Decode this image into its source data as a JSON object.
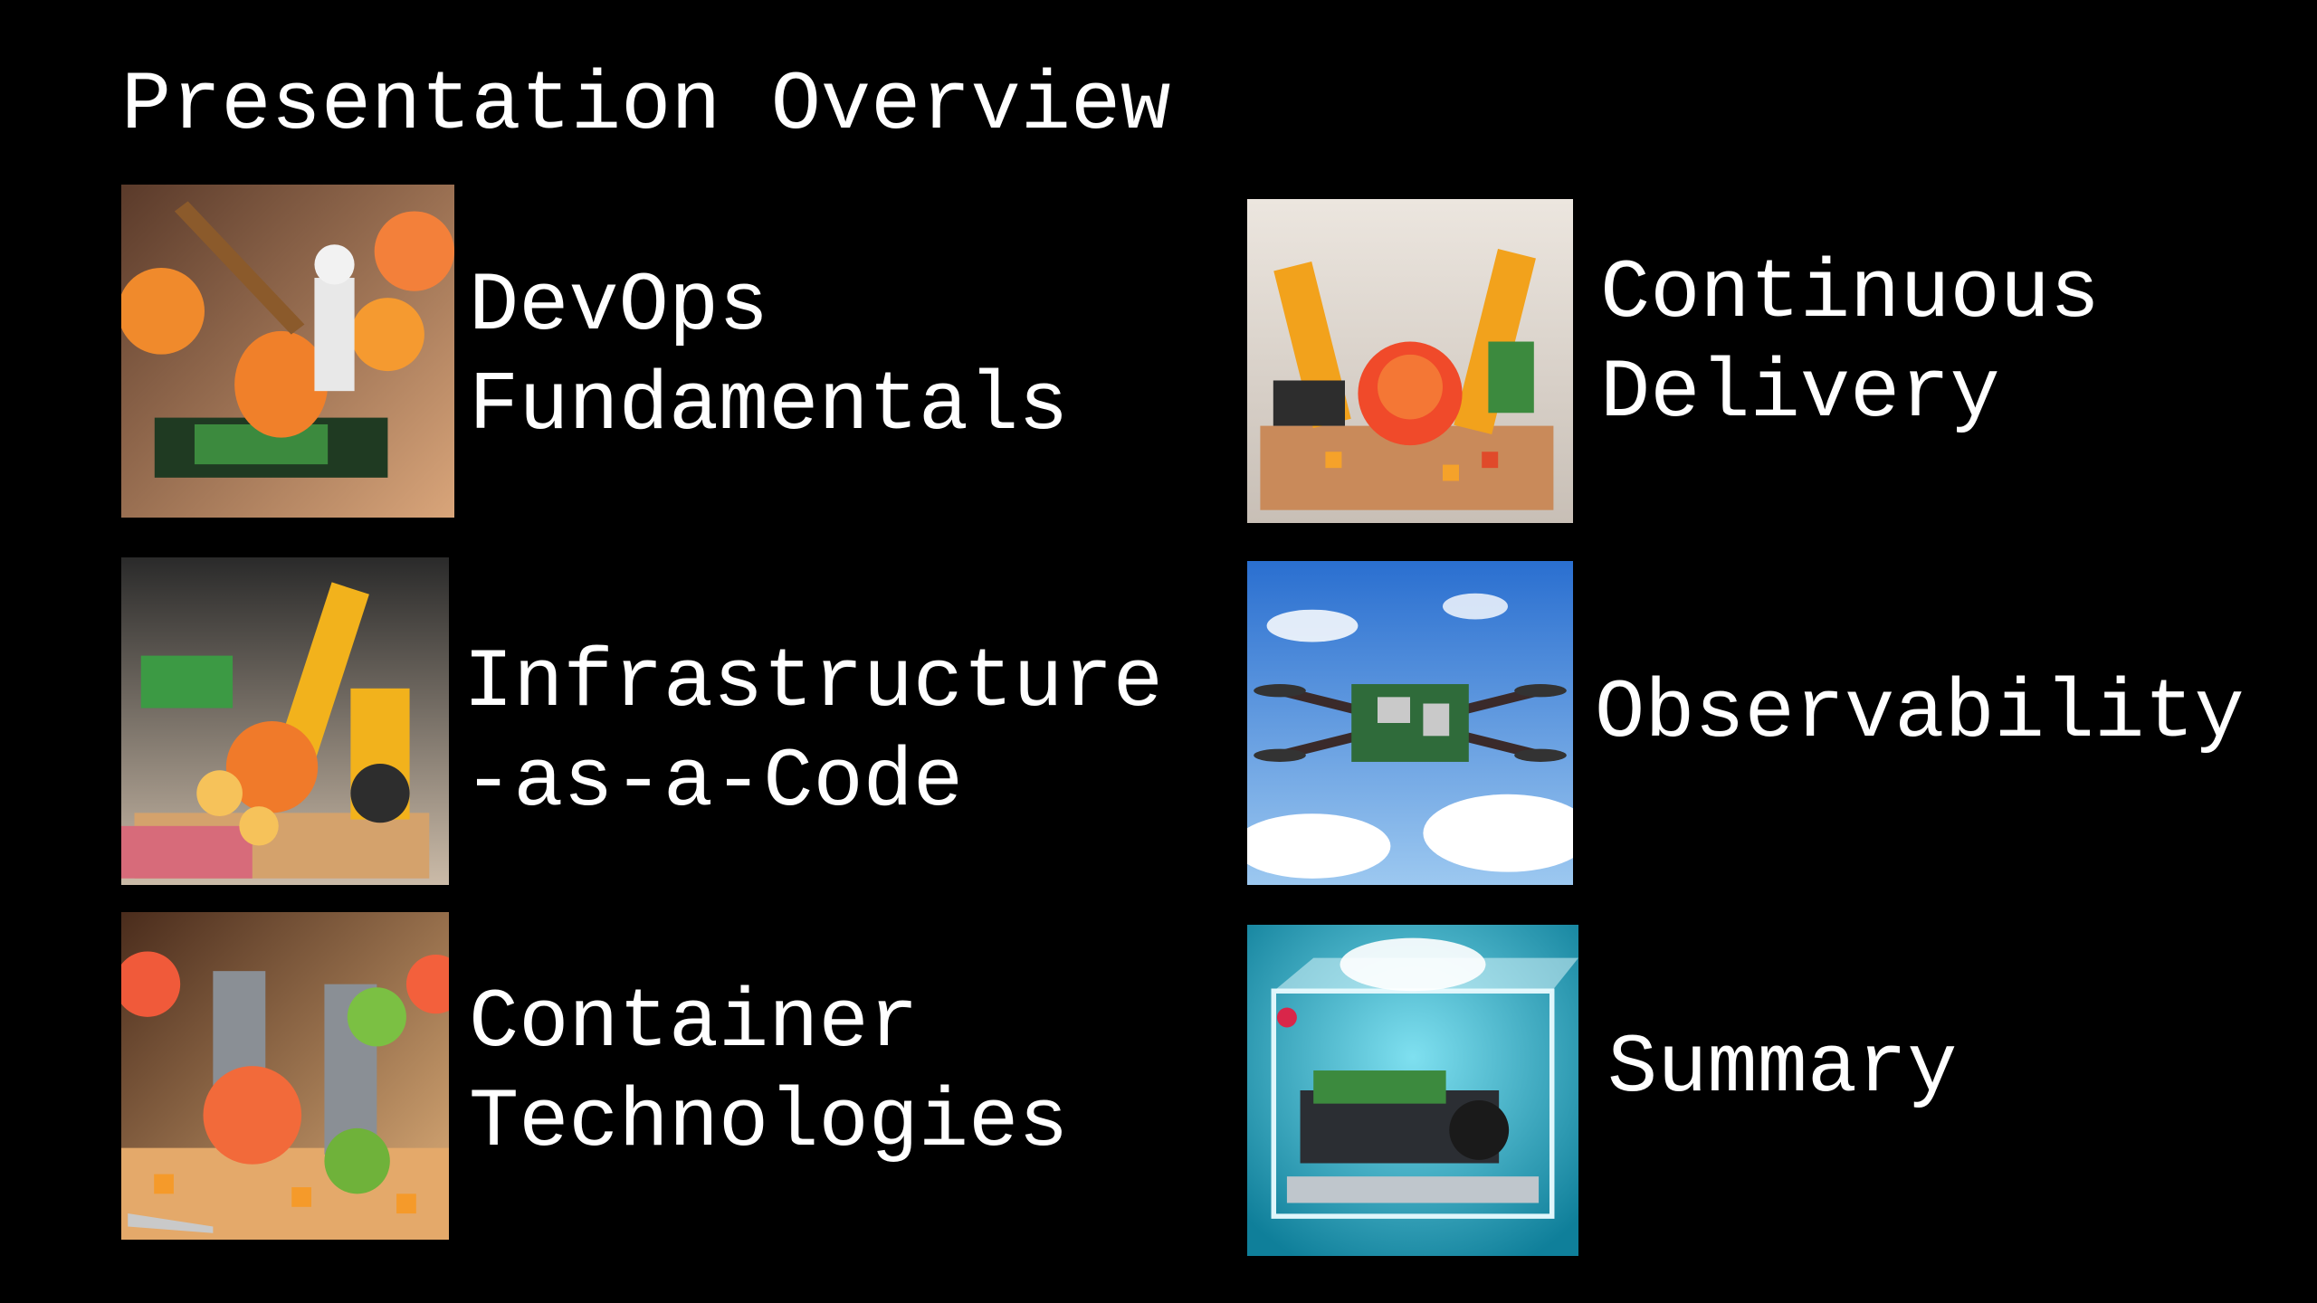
{
  "slide": {
    "title": "Presentation Overview",
    "items": [
      {
        "line1": "DevOps",
        "line2": "Fundamentals",
        "image_icon": "peach-robot-image"
      },
      {
        "line1": "Infrastructure",
        "line2": "-as-a-Code",
        "image_icon": "robot-arm-peach-image"
      },
      {
        "line1": "Container",
        "line2": "Technologies",
        "image_icon": "container-robot-image"
      },
      {
        "line1": "Continuous",
        "line2": "Delivery",
        "image_icon": "twin-robot-arms-image"
      },
      {
        "line1": "Observability",
        "line2": "",
        "image_icon": "drone-image"
      },
      {
        "line1": "Summary",
        "line2": "",
        "image_icon": "water-cube-image"
      }
    ]
  }
}
